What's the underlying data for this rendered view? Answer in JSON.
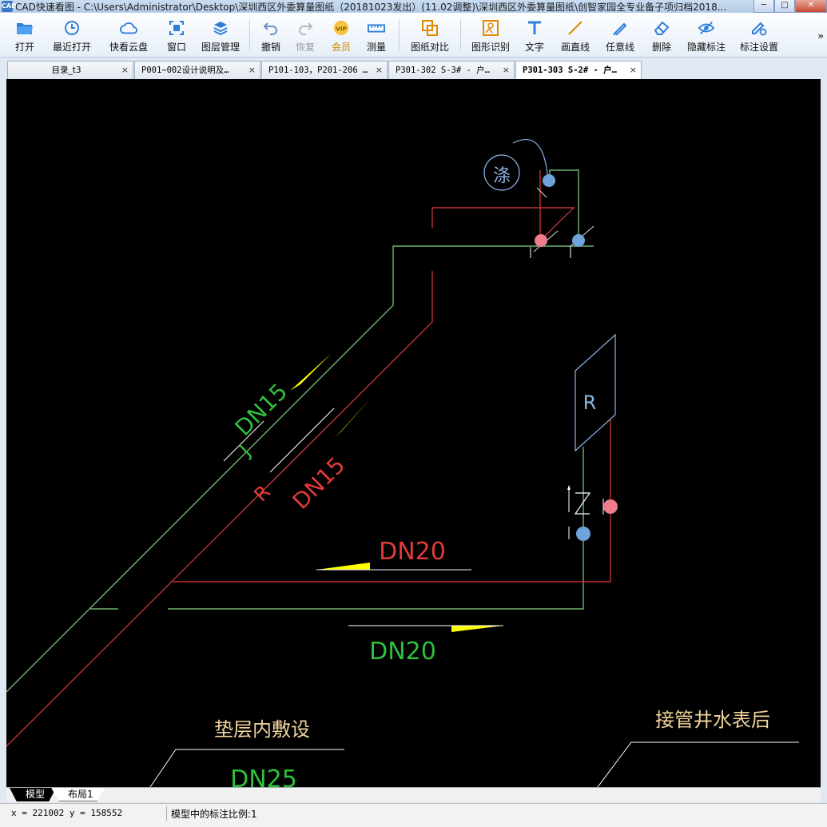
{
  "window": {
    "app_icon": "cad-app-icon",
    "app_icon_text": "CAD",
    "title": "CAD快速看图 - C:\\Users\\Administrator\\Desktop\\深圳西区外委算量图纸（20181023发出）(11.02调整)\\深圳西区外委算量图纸\\创智家园全专业备子项归档2018...",
    "minimize": "─",
    "maximize": "□",
    "close": "✕"
  },
  "toolbar": {
    "open": "打开",
    "recent": "最近打开",
    "cloud": "快看云盘",
    "window": "窗口",
    "layers": "图层管理",
    "undo": "撤销",
    "redo": "恢复",
    "vip": "会员",
    "measure": "测量",
    "compare": "图纸对比",
    "recognize": "图形识别",
    "text": "文字",
    "line": "画直线",
    "freeline": "任意线",
    "delete": "删除",
    "hide_marks": "隐藏标注",
    "mark_settings": "标注设置",
    "more": "»"
  },
  "tabs": [
    {
      "label": "目录_t3"
    },
    {
      "label": "P001~002设计说明及…"
    },
    {
      "label": "P101-103，P201-206 …"
    },
    {
      "label": "P301-302 S-3# - 户…"
    },
    {
      "label": "P301-303 S-2# - 户…"
    }
  ],
  "tab_close": "×",
  "drawing": {
    "fixture_label": "涤",
    "meter_label": "R",
    "pipe_j_label": "J",
    "pipe_r_label": "R",
    "dn15_green": "DN15",
    "dn15_red": "DN15",
    "dn20_red": "DN20",
    "dn20_green": "DN20",
    "note_left": "垫层内敷设",
    "note_right": "接管井水表后",
    "dn25_green": "DN25",
    "colors": {
      "green_pipe": "#7fd27f",
      "red_pipe": "#e23a3a",
      "blue_symbol": "#8ab4e6",
      "yellow_arrow": "#ffff00",
      "note_text": "#f0d49a",
      "green_text": "#2fbf3f"
    }
  },
  "layout_tabs": {
    "model": "模型",
    "layout1": "布局1"
  },
  "status": {
    "coords": "x = 221002  y = 158552",
    "scale_text": "模型中的标注比例:1"
  }
}
